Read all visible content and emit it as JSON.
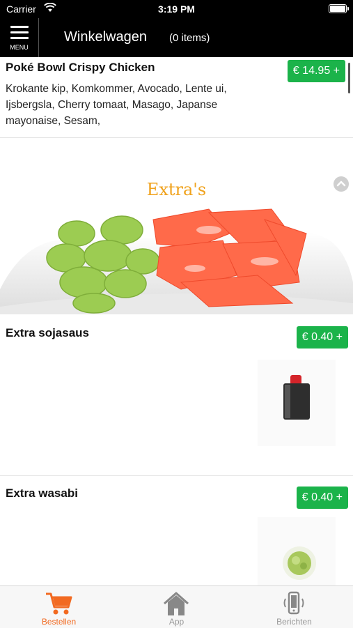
{
  "status_bar": {
    "carrier": "Carrier",
    "time": "3:19 PM"
  },
  "nav": {
    "menu_label": "MENU",
    "title": "Winkelwagen",
    "items_count": "(0 items)"
  },
  "products": [
    {
      "name": "Poké Bowl Crispy Chicken",
      "price": "€ 14.95 +",
      "description": "Krokante kip, Komkommer, Avocado, Lente ui, Ijsbergsla, Cherry tomaat, Masago, Japanse mayonaise, Sesam,"
    },
    {
      "name": "Extra sojasaus",
      "price": "€ 0.40 +"
    },
    {
      "name": "Extra wasabi",
      "price": "€ 0.40 +"
    }
  ],
  "section": {
    "title": "Extra's"
  },
  "tabs": [
    {
      "label": "Bestellen",
      "icon": "cart-icon",
      "active": true
    },
    {
      "label": "App",
      "icon": "home-icon",
      "active": false
    },
    {
      "label": "Berichten",
      "icon": "phone-notification-icon",
      "active": false
    }
  ],
  "colors": {
    "accent": "#f26a21",
    "price_green": "#1bb34a",
    "section_title": "#f0a21c",
    "header_bg": "#000000"
  }
}
